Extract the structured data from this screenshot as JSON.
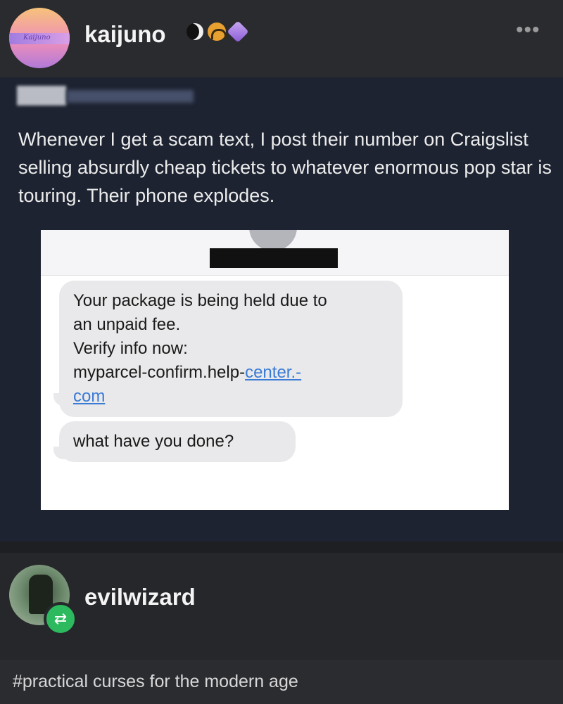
{
  "header": {
    "username": "kaijuno",
    "avatar_text": "Kaijuno",
    "badges": [
      "moon-badge-icon",
      "headphones-badge-icon",
      "gem-badge-icon"
    ],
    "more_label": "•••"
  },
  "post": {
    "text": "Whenever I get a scam text, I post their number on Craigslist selling absurdly cheap tickets to whatever enormous pop star is touring. Their phone explodes.",
    "screenshot": {
      "message1_lines": [
        "Your package is being held due to",
        "an unpaid fee.",
        "Verify info now:"
      ],
      "message1_link_prefix": "myparcel-confirm.help-",
      "message1_link_part1": "center.-",
      "message1_link_part2": "com",
      "message2": "what have you done?"
    }
  },
  "reblog": {
    "username": "evilwizard",
    "reblog_icon_glyph": "⇄"
  },
  "tags": {
    "text": "#practical curses for the modern age"
  },
  "colors": {
    "background": "#26272b",
    "post_background": "#1d2331",
    "reblog_green": "#2dba5f",
    "link_blue": "#3a7bd5"
  }
}
